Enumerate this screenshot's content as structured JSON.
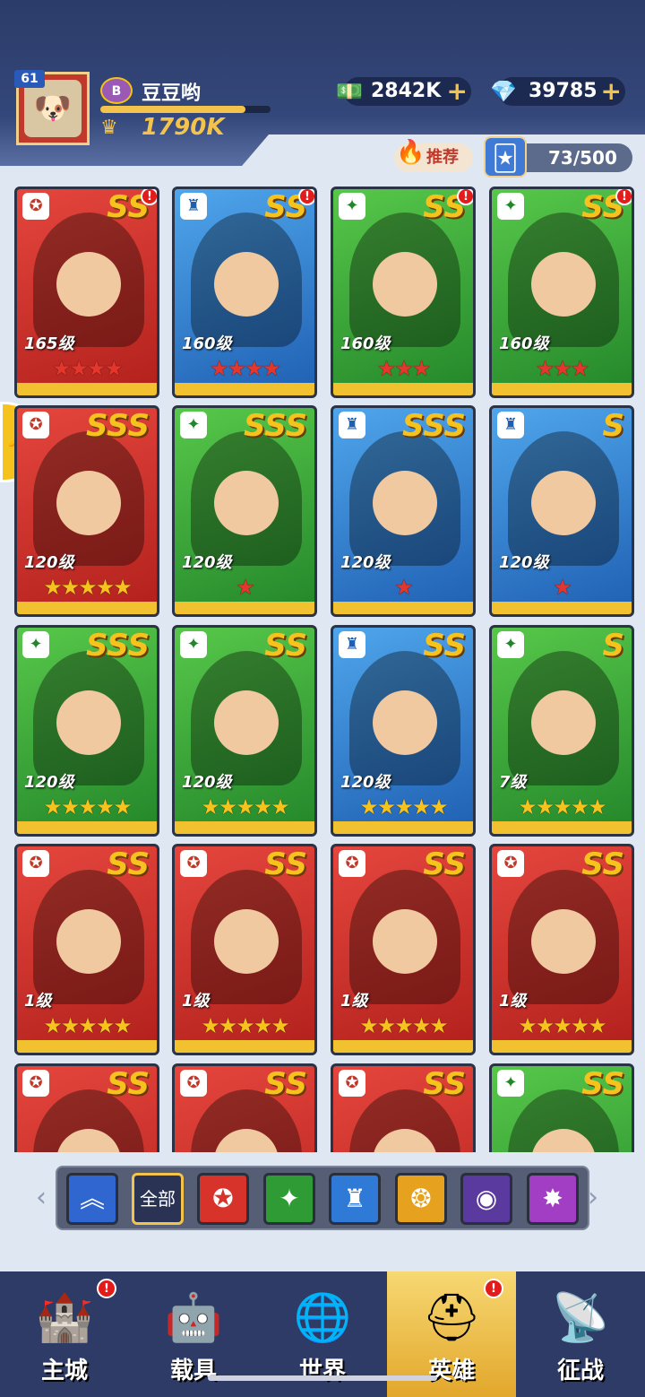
{
  "player": {
    "level": "61",
    "name": "豆豆哟",
    "rank_badge": "B",
    "power": "1790K",
    "exp_fraction": 0.85,
    "avatar_icon": "pug-avatar-icon"
  },
  "resources": {
    "cash": "2842K",
    "gems": "39785",
    "plus_glyph": "+"
  },
  "recommend_label": "推荐",
  "hero_capacity": "73/500",
  "alert_glyph": "!",
  "cards": [
    {
      "color": "red",
      "faction_glyph": "✪",
      "grade": "SS",
      "level": "165级",
      "stars": "★★★★",
      "star_color": "red",
      "alert": true
    },
    {
      "color": "blue",
      "faction_glyph": "♜",
      "grade": "SS",
      "level": "160级",
      "stars": "★★★★",
      "star_color": "red",
      "alert": true
    },
    {
      "color": "green",
      "faction_glyph": "✦",
      "grade": "SS",
      "level": "160级",
      "stars": "★★★",
      "star_color": "red",
      "alert": true
    },
    {
      "color": "green",
      "faction_glyph": "✦",
      "grade": "SS",
      "level": "160级",
      "stars": "★★★",
      "star_color": "red",
      "alert": true
    },
    {
      "color": "red",
      "faction_glyph": "✪",
      "grade": "SSS",
      "level": "120级",
      "stars": "★★★★★",
      "star_color": "gold",
      "alert": false
    },
    {
      "color": "green",
      "faction_glyph": "✦",
      "grade": "SSS",
      "level": "120级",
      "stars": "★",
      "star_color": "red",
      "alert": false
    },
    {
      "color": "blue",
      "faction_glyph": "♜",
      "grade": "SSS",
      "level": "120级",
      "stars": "★",
      "star_color": "red",
      "alert": false
    },
    {
      "color": "blue",
      "faction_glyph": "♜",
      "grade": "S",
      "level": "120级",
      "stars": "★",
      "star_color": "red",
      "alert": false
    },
    {
      "color": "green",
      "faction_glyph": "✦",
      "grade": "SSS",
      "level": "120级",
      "stars": "★★★★★",
      "star_color": "gold",
      "alert": false
    },
    {
      "color": "green",
      "faction_glyph": "✦",
      "grade": "SS",
      "level": "120级",
      "stars": "★★★★★",
      "star_color": "gold",
      "alert": false
    },
    {
      "color": "blue",
      "faction_glyph": "♜",
      "grade": "SS",
      "level": "120级",
      "stars": "★★★★★",
      "star_color": "gold",
      "alert": false
    },
    {
      "color": "green",
      "faction_glyph": "✦",
      "grade": "S",
      "level": "7级",
      "stars": "★★★★★",
      "star_color": "gold",
      "alert": false
    },
    {
      "color": "red",
      "faction_glyph": "✪",
      "grade": "SS",
      "level": "1级",
      "stars": "★★★★★",
      "star_color": "gold",
      "alert": false
    },
    {
      "color": "red",
      "faction_glyph": "✪",
      "grade": "SS",
      "level": "1级",
      "stars": "★★★★★",
      "star_color": "gold",
      "alert": false
    },
    {
      "color": "red",
      "faction_glyph": "✪",
      "grade": "SS",
      "level": "1级",
      "stars": "★★★★★",
      "star_color": "gold",
      "alert": false
    },
    {
      "color": "red",
      "faction_glyph": "✪",
      "grade": "SS",
      "level": "1级",
      "stars": "★★★★★",
      "star_color": "gold",
      "alert": false
    },
    {
      "color": "red",
      "faction_glyph": "✪",
      "grade": "SS",
      "level": "",
      "stars": "",
      "star_color": "gold",
      "alert": false
    },
    {
      "color": "red",
      "faction_glyph": "✪",
      "grade": "SS",
      "level": "",
      "stars": "",
      "star_color": "gold",
      "alert": false
    },
    {
      "color": "red",
      "faction_glyph": "✪",
      "grade": "SS",
      "level": "",
      "stars": "",
      "star_color": "gold",
      "alert": false
    },
    {
      "color": "green",
      "faction_glyph": "✦",
      "grade": "SS",
      "level": "",
      "stars": "",
      "star_color": "gold",
      "alert": false
    }
  ],
  "filters": {
    "all_label": "全部",
    "items": [
      {
        "icon": "chevron-up-icon",
        "glyph": "︽",
        "bg": "#2f66d0"
      },
      {
        "icon": "all",
        "glyph": "",
        "bg": "#2b3354"
      },
      {
        "icon": "red-faction-icon",
        "glyph": "✪",
        "bg": "#d7332b"
      },
      {
        "icon": "green-faction-icon",
        "glyph": "✦",
        "bg": "#2e9b35"
      },
      {
        "icon": "blue-faction-icon",
        "glyph": "♜",
        "bg": "#2f7ad6"
      },
      {
        "icon": "gold-faction-icon",
        "glyph": "❂",
        "bg": "#e6a21e"
      },
      {
        "icon": "purple-eye-icon",
        "glyph": "◉",
        "bg": "#5b3aa0"
      },
      {
        "icon": "vortex-icon",
        "glyph": "✸",
        "bg": "#a23ec4"
      }
    ]
  },
  "nav": [
    {
      "label": "主城",
      "icon": "castle-icon",
      "glyph": "🏰",
      "alert": true,
      "active": false
    },
    {
      "label": "载具",
      "icon": "mech-icon",
      "glyph": "🤖",
      "alert": false,
      "active": false
    },
    {
      "label": "世界",
      "icon": "globe-icon",
      "glyph": "🌐",
      "alert": false,
      "active": false
    },
    {
      "label": "英雄",
      "icon": "hero-helmet-icon",
      "glyph": "⛑",
      "alert": true,
      "active": true
    },
    {
      "label": "征战",
      "icon": "radar-icon",
      "glyph": "📡",
      "alert": false,
      "active": false
    }
  ]
}
